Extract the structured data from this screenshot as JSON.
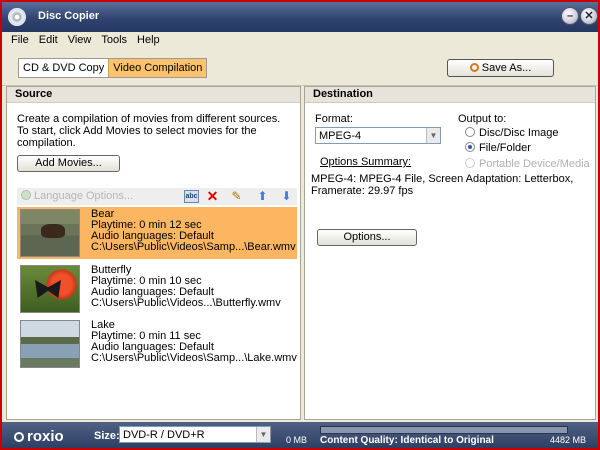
{
  "window": {
    "title": "Disc Copier"
  },
  "menu": [
    "File",
    "Edit",
    "View",
    "Tools",
    "Help"
  ],
  "toolbar": {
    "mode_tabs": [
      {
        "label": "CD & DVD Copy",
        "active": false
      },
      {
        "label": "Video Compilation",
        "active": true
      }
    ],
    "save_as_label": "Save As..."
  },
  "source": {
    "header": "Source",
    "instructions": "Create a compilation of movies from different sources. To start, click Add Movies to select movies for the compilation.",
    "add_movies_label": "Add Movies...",
    "language_options_label": "Language Options...",
    "items": [
      {
        "title": "Bear",
        "playtime": "Playtime: 0 min 12 sec",
        "audio": "Audio languages: Default",
        "path": "C:\\Users\\Public\\Videos\\Samp...\\Bear.wmv",
        "selected": true
      },
      {
        "title": "Butterfly",
        "playtime": "Playtime: 0 min 10 sec",
        "audio": "Audio languages: Default",
        "path": "C:\\Users\\Public\\Videos...\\Butterfly.wmv",
        "selected": false
      },
      {
        "title": "Lake",
        "playtime": "Playtime: 0 min 11 sec",
        "audio": "Audio languages: Default",
        "path": "C:\\Users\\Public\\Videos\\Samp...\\Lake.wmv",
        "selected": false
      }
    ]
  },
  "destination": {
    "header": "Destination",
    "format_label": "Format:",
    "format_value": "MPEG-4",
    "output_label": "Output to:",
    "outputs": [
      {
        "label": "Disc/Disc Image",
        "selected": false,
        "disabled": false
      },
      {
        "label": "File/Folder",
        "selected": true,
        "disabled": false
      },
      {
        "label": "Portable Device/Media",
        "selected": false,
        "disabled": true
      }
    ],
    "options_summary_label": "Options Summary:",
    "options_summary": "MPEG-4:  MPEG-4 File, Screen Adaptation: Letterbox, Framerate: 29.97 fps",
    "options_button_label": "Options..."
  },
  "statusbar": {
    "logo": "roxio",
    "size_label": "Size:",
    "size_value": "DVD-R / DVD+R",
    "used_mb": "0 MB",
    "capacity_mb": "4482 MB",
    "used_fraction": 0,
    "quality": "Content Quality: Identical to Original"
  }
}
